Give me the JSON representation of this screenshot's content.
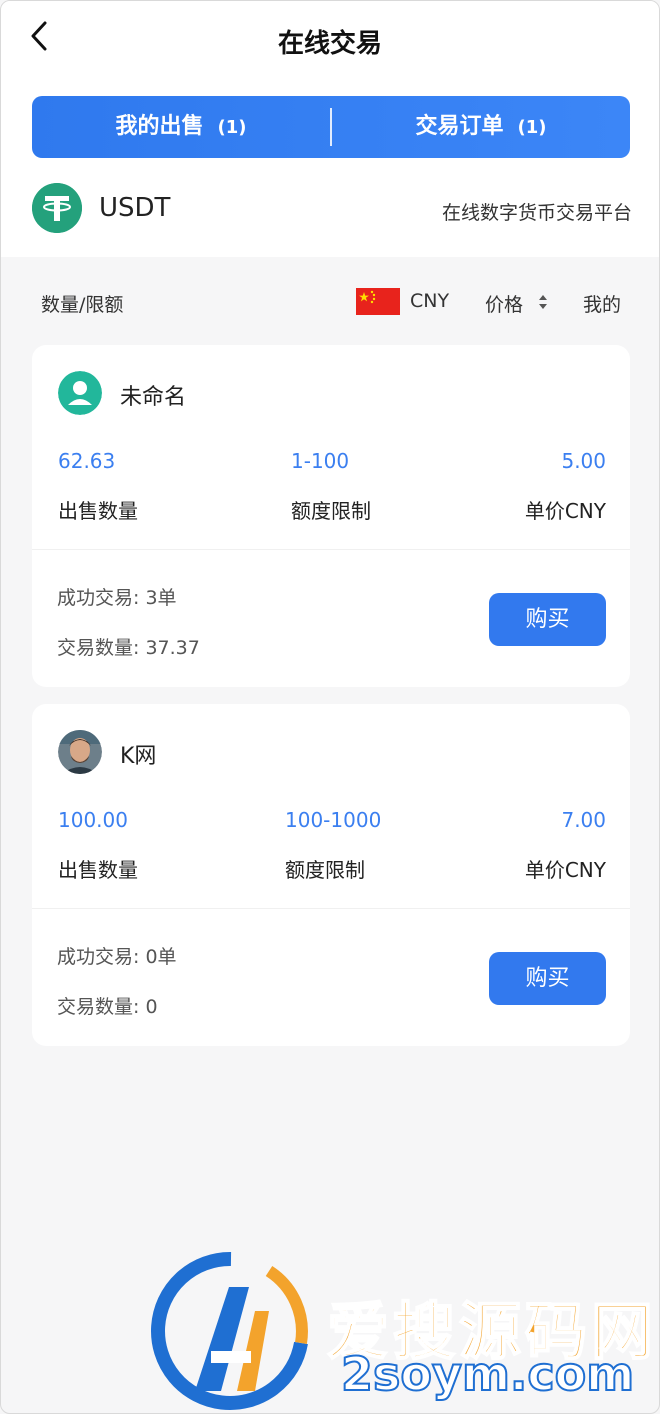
{
  "header": {
    "title": "在线交易"
  },
  "tabs": [
    {
      "label": "我的出售",
      "count": "(1)"
    },
    {
      "label": "交易订单",
      "count": "(1)"
    }
  ],
  "coin": {
    "name": "USDT",
    "tagline": "在线数字货币交易平台"
  },
  "filter": {
    "label": "数量/限额",
    "currency": "CNY",
    "price": "价格",
    "mine": "我的"
  },
  "listings": [
    {
      "seller": "未命名",
      "amount": "62.63",
      "limit": "1-100",
      "unit_price": "5.00",
      "amount_label": "出售数量",
      "limit_label": "额度限制",
      "price_label": "单价CNY",
      "success_trades": "成功交易: 3单",
      "trade_volume": "交易数量: 37.37",
      "buy_label": "购买"
    },
    {
      "seller": "K网",
      "amount": "100.00",
      "limit": "100-1000",
      "unit_price": "7.00",
      "amount_label": "出售数量",
      "limit_label": "额度限制",
      "price_label": "单价CNY",
      "success_trades": "成功交易: 0单",
      "trade_volume": "交易数量: 0",
      "buy_label": "购买"
    }
  ],
  "watermark": {
    "text_cn": "爱搜源码网",
    "text_en": "2soym.com"
  },
  "colors": {
    "accent": "#3279ee",
    "value_blue": "#3b7ff0",
    "usdt_green": "#24a17c",
    "flag_red": "#e8231c"
  }
}
